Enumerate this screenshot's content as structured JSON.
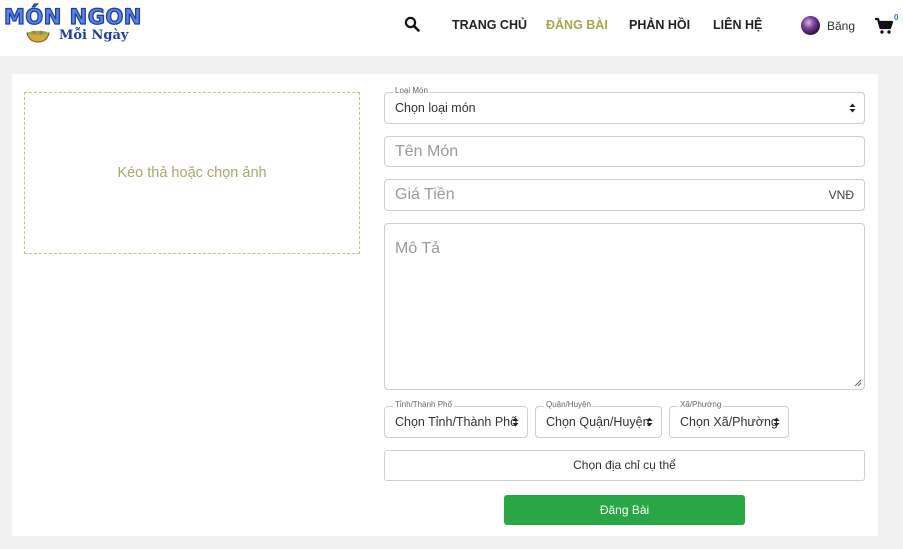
{
  "logo": {
    "line1": "MÓN NGON",
    "line2": "Mỗi Ngày"
  },
  "nav": {
    "search_icon": "search-icon",
    "items": [
      {
        "label": "TRANG CHỦ",
        "active": false
      },
      {
        "label": "ĐĂNG BÀI",
        "active": true
      },
      {
        "label": "PHẢN HỒI",
        "active": false
      },
      {
        "label": "LIÊN HỆ",
        "active": false
      }
    ],
    "active_color": "#a8a64a"
  },
  "user": {
    "name": "Băng"
  },
  "cart": {
    "icon": "cart-icon",
    "count": "0"
  },
  "form": {
    "dropzone_text": "Kéo thả hoặc chọn ảnh",
    "category": {
      "label": "Loại Món",
      "value": "Chọn loại món"
    },
    "name": {
      "placeholder": "Tên Món"
    },
    "price": {
      "placeholder": "Giá Tiền",
      "unit": "VNĐ"
    },
    "description": {
      "placeholder": "Mô Tả"
    },
    "province": {
      "label": "Tỉnh/Thành Phố",
      "value": "Chọn Tỉnh/Thành Phố"
    },
    "district": {
      "label": "Quận/Huyện",
      "value": "Chọn Quận/Huyện"
    },
    "ward": {
      "label": "Xã/Phường",
      "value": "Chọn Xã/Phường"
    },
    "address_button": "Chọn địa chỉ cụ thể",
    "submit_button": "Đăng Bài"
  },
  "colors": {
    "submit": "#2aa745",
    "logo_blue": "#5a83e8",
    "dropzone_border": "#c7c47d"
  }
}
